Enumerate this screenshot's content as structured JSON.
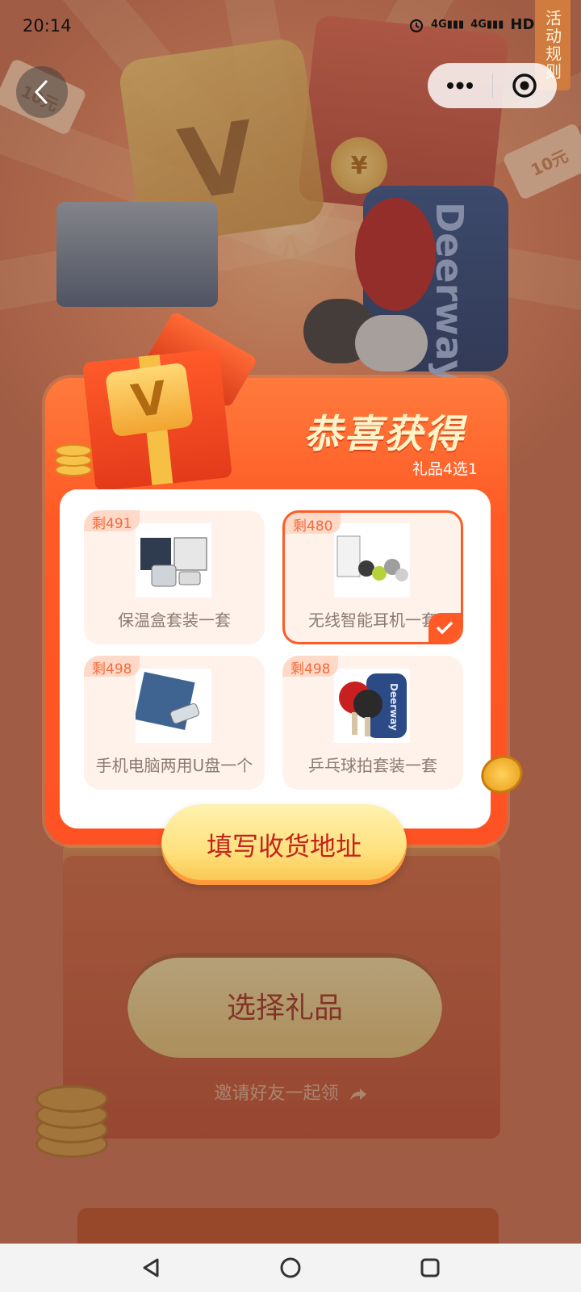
{
  "status_bar": {
    "time": "20:14",
    "network_1": "4G",
    "network_2": "4G",
    "hd": "HD"
  },
  "rules_tab": "活动规则",
  "popup": {
    "title": "恭喜获得",
    "subtitle": "礼品4选1",
    "gifts": [
      {
        "stock": "剩491",
        "name": "保温盒套装一套",
        "selected": false
      },
      {
        "stock": "剩480",
        "name": "无线智能耳机一套",
        "selected": true
      },
      {
        "stock": "剩498",
        "name": "手机电脑两用U盘一个",
        "selected": false
      },
      {
        "stock": "剩498",
        "name": "乒乓球拍套装一套",
        "selected": false
      }
    ],
    "address_button": "填写收货地址"
  },
  "background": {
    "select_gift_button": "选择礼品",
    "invite_text": "邀请好友一起领",
    "bag_brand": "Deerway",
    "coupon_label": "10元",
    "yen_symbol": "¥",
    "crown_letter": "V"
  },
  "colors": {
    "accent": "#ff5a25",
    "title_text": "#fff3c8",
    "button_text": "#c4231b"
  }
}
